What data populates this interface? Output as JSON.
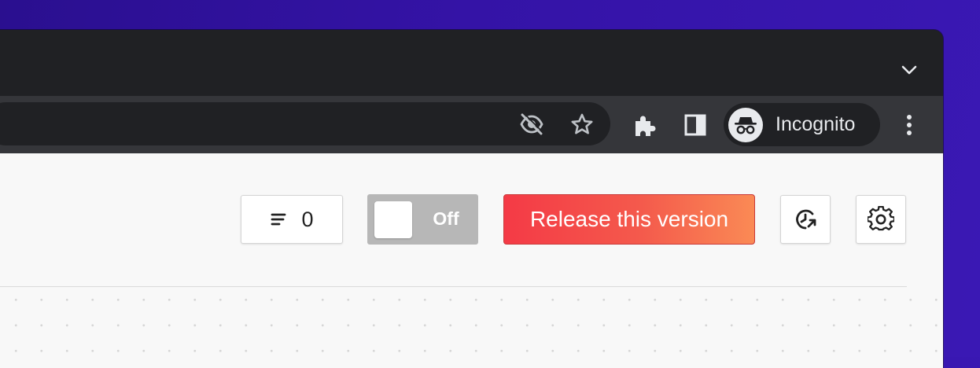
{
  "browser": {
    "tab_menu_icon": "chevron-down-icon",
    "omnibox_icons": [
      "eye-off-icon",
      "star-icon"
    ],
    "toolbar_icons": [
      "puzzle-icon",
      "side-panel-icon",
      "more-vert-icon"
    ],
    "profile": {
      "label": "Incognito",
      "icon": "incognito-icon"
    }
  },
  "app_toolbar": {
    "comments": {
      "icon": "comment-lines-icon",
      "count": "0"
    },
    "toggle": {
      "label": "Off",
      "state": "off"
    },
    "release_button": {
      "label": "Release this version",
      "gradient": [
        "#f43a46",
        "#fa8a55"
      ]
    },
    "history_button": {
      "icon": "history-icon"
    },
    "settings_button": {
      "icon": "gear-icon"
    }
  },
  "colors": {
    "desktop_bg": "#3413a6",
    "browser_frame": "#202124",
    "toolbar": "#35363a",
    "page_bg": "#f8f8f8",
    "toggle_off": "#b7b7b7"
  }
}
